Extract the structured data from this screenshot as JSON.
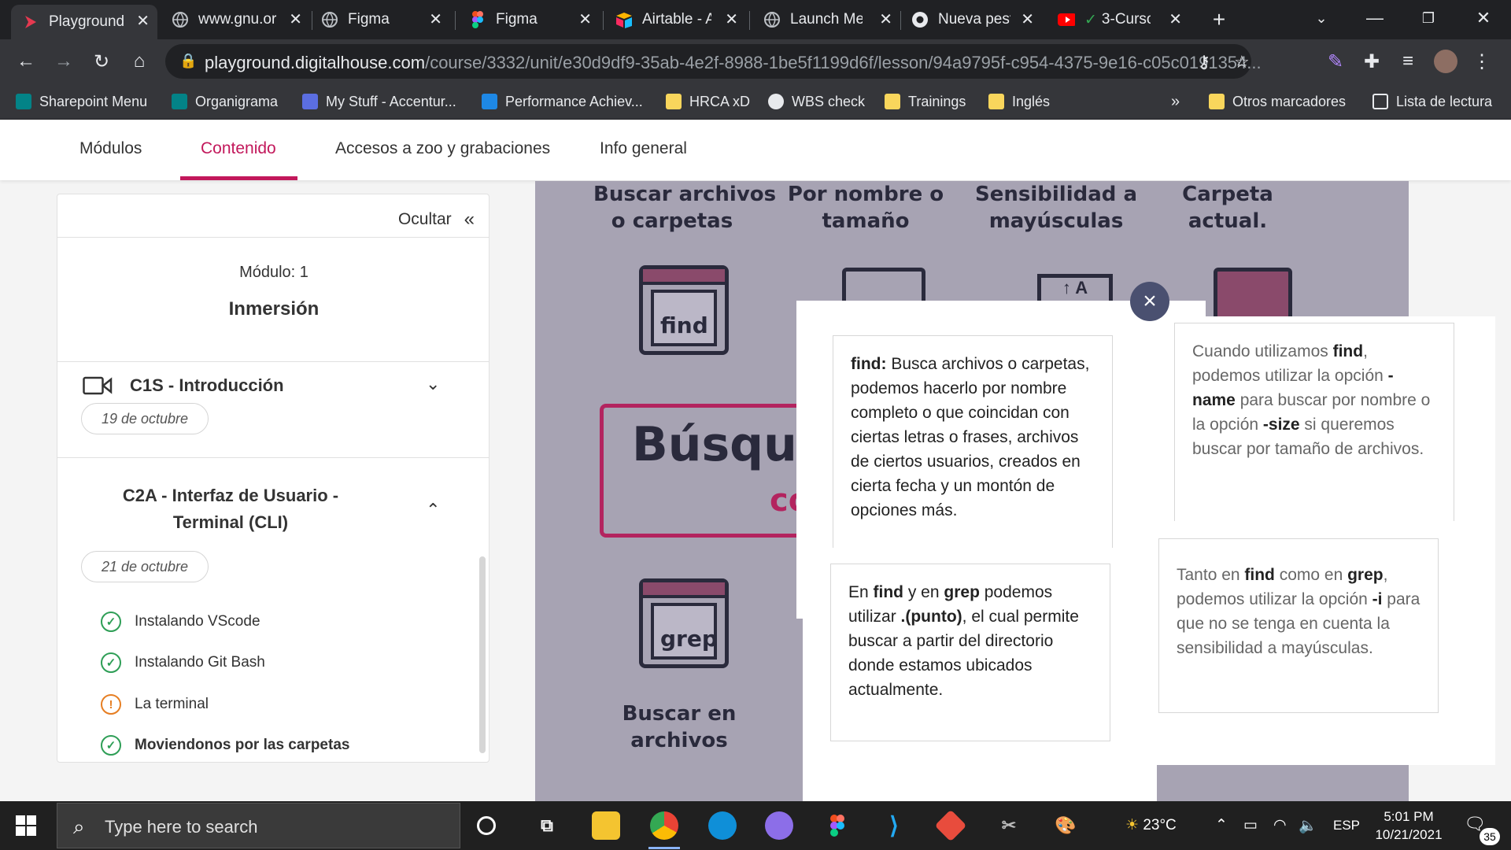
{
  "browser": {
    "tabs": [
      {
        "title": "Playground",
        "icon": "playground-icon",
        "active": true
      },
      {
        "title": "www.gnu.or",
        "icon": "globe-icon"
      },
      {
        "title": "Figma",
        "icon": "globe-icon"
      },
      {
        "title": "Figma",
        "icon": "figma-icon"
      },
      {
        "title": "Airtable - A",
        "icon": "airtable-icon"
      },
      {
        "title": "Launch Me",
        "icon": "globe-icon"
      },
      {
        "title": "Nueva pest",
        "icon": "chrome-icon"
      },
      {
        "title": "3-Curso",
        "icon": "youtube-icon"
      }
    ],
    "url_domain": "playground.digitalhouse.com",
    "url_path": "/course/3332/unit/e30d9df9-35ab-4e2f-8988-1be5f1199d6f/lesson/94a9795f-c954-4375-9e16-c05c0191354...",
    "bookmarks": [
      {
        "label": "Sharepoint Menu",
        "color": "#038387"
      },
      {
        "label": "Organigrama",
        "color": "#038387"
      },
      {
        "label": "My Stuff - Accentur...",
        "color": "#5b6ee1"
      },
      {
        "label": "Performance Achiev...",
        "color": "#1e88e5"
      },
      {
        "label": "HRCA xD",
        "color": "#f9d65c"
      },
      {
        "label": "WBS check",
        "color": "#e8eaed"
      },
      {
        "label": "Trainings",
        "color": "#f9d65c"
      },
      {
        "label": "Inglés",
        "color": "#f9d65c"
      }
    ],
    "bookmarks_more": "»",
    "other_bookmarks": "Otros marcadores",
    "reading_list": "Lista de lectura"
  },
  "course_nav": {
    "items": [
      "Módulos",
      "Contenido",
      "Accesos a zoo y grabaciones",
      "Info general"
    ],
    "active": "Contenido"
  },
  "sidebar": {
    "hide_label": "Ocultar",
    "hide_icon": "«",
    "module_label": "Módulo:  1",
    "module_title": "Inmersión",
    "classes": [
      {
        "title": "C1S - Introducción",
        "date": "19 de octubre"
      },
      {
        "title": "C2A - Interfaz de Usuario - Terminal (CLI)",
        "date": "21 de octubre"
      }
    ],
    "lessons": [
      {
        "label": "Instalando VScode",
        "status": "done"
      },
      {
        "label": "Instalando Git Bash",
        "status": "done"
      },
      {
        "label": "La terminal",
        "status": "pending"
      },
      {
        "label": "Moviendonos por las carpetas",
        "status": "done"
      }
    ]
  },
  "infographic": {
    "labels_top": [
      "Buscar archivos\no carpetas",
      "Por nombre o\ntamaño",
      "Sensibilidad a\nmayúsculas",
      "Carpeta\nactual."
    ],
    "find_cmd": "find",
    "grep_cmd": "grep",
    "grep_label": "Buscar en\narchivos",
    "title_partial": "Búsque",
    "subtitle_partial": "co"
  },
  "modal": {
    "close_icon": "×",
    "card1": {
      "term": "find:",
      "text": " Busca archivos o carpetas, podemos hacerlo por nombre completo o que coincidan con ciertas letras o frases, archivos de ciertos usuarios, creados en cierta fecha y un montón de opciones más."
    },
    "card2": {
      "t1": "Cuando utilizamos ",
      "b1": "find",
      "t2": ", podemos utilizar la opción ",
      "b2": "-name",
      "t3": " para buscar por nombre o la opción ",
      "b3": "-size",
      "t4": " si queremos buscar por tamaño de archivos."
    },
    "card3": {
      "t1": "En ",
      "b1": "find",
      "t2": " y en ",
      "b2": "grep",
      "t3": " podemos utilizar ",
      "b3": ".(punto)",
      "t4": ", el cual permite buscar a partir del directorio donde estamos ubicados actualmente."
    },
    "card4": {
      "t1": "Tanto en ",
      "b1": "find",
      "t2": " como en ",
      "b2": "grep",
      "t3": ", podemos utilizar la opción ",
      "b3": "-i",
      "t4": " para que no se tenga en cuenta la sensibilidad a mayúsculas."
    }
  },
  "taskbar": {
    "search_placeholder": "Type here to search",
    "weather": "23°C",
    "language": "ESP",
    "time": "5:01 PM",
    "date": "10/21/2021",
    "notifications": "35"
  }
}
